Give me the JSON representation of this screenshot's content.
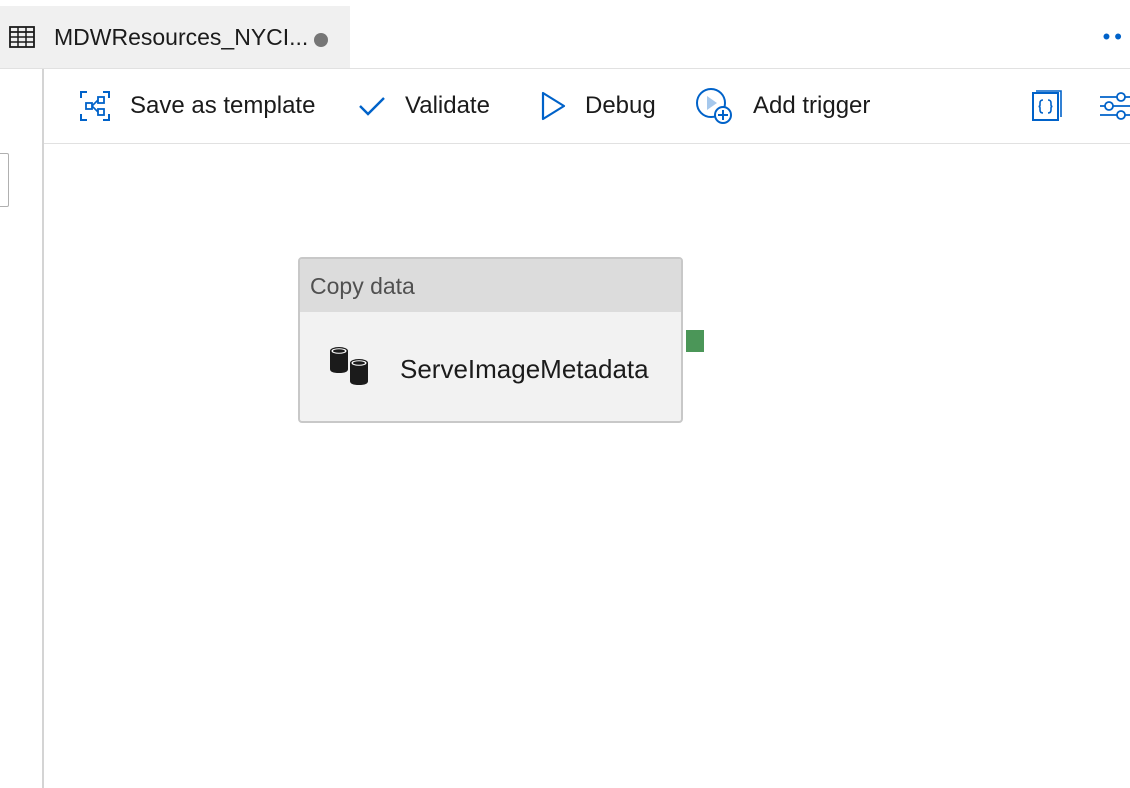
{
  "tab": {
    "title": "MDWResources_NYCI...",
    "icon": "table-icon",
    "unsaved_indicator": "unsaved-dot",
    "more": "••"
  },
  "toolbar": {
    "save_template_label": "Save as template",
    "validate_label": "Validate",
    "debug_label": "Debug",
    "add_trigger_label": "Add trigger",
    "code_icon": "code-braces-icon",
    "properties_icon": "properties-sliders-icon"
  },
  "activity": {
    "type": "Copy data",
    "name": "ServeImageMetadata",
    "icon": "database-copy-icon"
  },
  "colors": {
    "accent": "#0062c9",
    "success_handle": "#4b9658",
    "tab_bg": "#f0f0f0",
    "activity_header": "#dcdcdc"
  }
}
